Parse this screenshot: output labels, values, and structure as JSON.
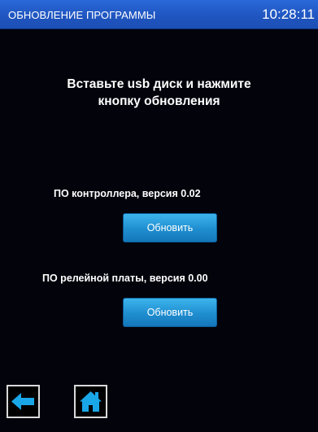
{
  "header": {
    "title": "ОБНОВЛЕНИЕ ПРОГРАММЫ",
    "time": "10:28:11"
  },
  "instruction": {
    "line1": "Вставьте usb диск и нажмите",
    "line2": "кнопку обновления"
  },
  "controller": {
    "label": "ПО контроллера, версия 0.02",
    "button_label": "Обновить"
  },
  "relay_board": {
    "label": "ПО релейной платы, версия 0.00",
    "button_label": "Обновить"
  },
  "nav": {
    "back_icon": "arrow-left-icon",
    "home_icon": "home-icon"
  },
  "colors": {
    "header": "#2360cc",
    "background": "#03030c",
    "button": "#1f8ed0",
    "icon": "#1aa7e8"
  }
}
